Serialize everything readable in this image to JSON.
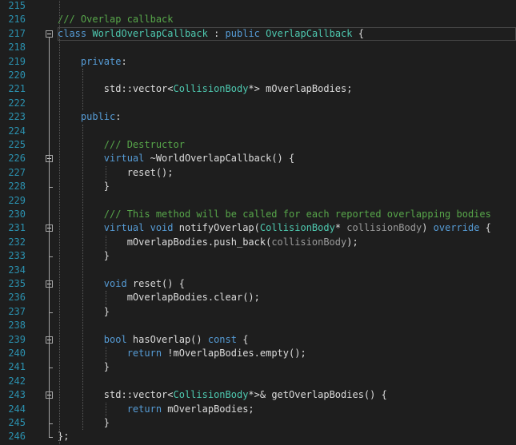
{
  "theme": {
    "background": "#1e1e1e",
    "line_number_color": "#2b91af",
    "keyword_color": "#569cd6",
    "type_color": "#4ec9b0",
    "comment_color": "#57a64a",
    "text_color": "#dcdcdc",
    "parameter_color": "#9a9a9a"
  },
  "icons": {
    "fold": "collapse-minus-icon"
  },
  "current_line": 217,
  "lines": [
    {
      "num": "215",
      "fold": false,
      "segments": []
    },
    {
      "num": "216",
      "fold": false,
      "segments": [
        [
          "cm",
          "/// Overlap callback"
        ]
      ]
    },
    {
      "num": "217",
      "fold": true,
      "segments": [
        [
          "kw",
          "class"
        ],
        [
          "tx",
          " "
        ],
        [
          "ty",
          "WorldOverlapCallback"
        ],
        [
          "tx",
          " : "
        ],
        [
          "kw",
          "public"
        ],
        [
          "tx",
          " "
        ],
        [
          "ty",
          "OverlapCallback"
        ],
        [
          "tx",
          " {"
        ]
      ]
    },
    {
      "num": "218",
      "fold": false,
      "segments": []
    },
    {
      "num": "219",
      "fold": false,
      "segments": [
        [
          "tx",
          "    "
        ],
        [
          "kw",
          "private"
        ],
        [
          "tx",
          ":"
        ]
      ]
    },
    {
      "num": "220",
      "fold": false,
      "segments": []
    },
    {
      "num": "221",
      "fold": false,
      "segments": [
        [
          "tx",
          "        std::vector<"
        ],
        [
          "ty",
          "CollisionBody"
        ],
        [
          "tx",
          "*> mOverlapBodies;"
        ]
      ]
    },
    {
      "num": "222",
      "fold": false,
      "segments": []
    },
    {
      "num": "223",
      "fold": false,
      "segments": [
        [
          "tx",
          "    "
        ],
        [
          "kw",
          "public"
        ],
        [
          "tx",
          ":"
        ]
      ]
    },
    {
      "num": "224",
      "fold": false,
      "segments": []
    },
    {
      "num": "225",
      "fold": false,
      "segments": [
        [
          "tx",
          "        "
        ],
        [
          "cm",
          "/// Destructor"
        ]
      ]
    },
    {
      "num": "226",
      "fold": true,
      "segments": [
        [
          "tx",
          "        "
        ],
        [
          "kw",
          "virtual"
        ],
        [
          "tx",
          " ~WorldOverlapCallback() {"
        ]
      ]
    },
    {
      "num": "227",
      "fold": false,
      "segments": [
        [
          "tx",
          "            reset();"
        ]
      ]
    },
    {
      "num": "228",
      "fold": false,
      "segments": [
        [
          "tx",
          "        }"
        ]
      ]
    },
    {
      "num": "229",
      "fold": false,
      "segments": []
    },
    {
      "num": "230",
      "fold": false,
      "segments": [
        [
          "tx",
          "        "
        ],
        [
          "cm",
          "/// This method will be called for each reported overlapping bodies"
        ]
      ]
    },
    {
      "num": "231",
      "fold": true,
      "segments": [
        [
          "tx",
          "        "
        ],
        [
          "kw",
          "virtual"
        ],
        [
          "tx",
          " "
        ],
        [
          "kw",
          "void"
        ],
        [
          "tx",
          " notifyOverlap("
        ],
        [
          "ty",
          "CollisionBody"
        ],
        [
          "tx",
          "* "
        ],
        [
          "pm",
          "collisionBody"
        ],
        [
          "tx",
          ") "
        ],
        [
          "kw",
          "override"
        ],
        [
          "tx",
          " {"
        ]
      ]
    },
    {
      "num": "232",
      "fold": false,
      "segments": [
        [
          "tx",
          "            mOverlapBodies.push_back("
        ],
        [
          "pm",
          "collisionBody"
        ],
        [
          "tx",
          ");"
        ]
      ]
    },
    {
      "num": "233",
      "fold": false,
      "segments": [
        [
          "tx",
          "        }"
        ]
      ]
    },
    {
      "num": "234",
      "fold": false,
      "segments": []
    },
    {
      "num": "235",
      "fold": true,
      "segments": [
        [
          "tx",
          "        "
        ],
        [
          "kw",
          "void"
        ],
        [
          "tx",
          " reset() {"
        ]
      ]
    },
    {
      "num": "236",
      "fold": false,
      "segments": [
        [
          "tx",
          "            mOverlapBodies.clear();"
        ]
      ]
    },
    {
      "num": "237",
      "fold": false,
      "segments": [
        [
          "tx",
          "        }"
        ]
      ]
    },
    {
      "num": "238",
      "fold": false,
      "segments": []
    },
    {
      "num": "239",
      "fold": true,
      "segments": [
        [
          "tx",
          "        "
        ],
        [
          "kw",
          "bool"
        ],
        [
          "tx",
          " hasOverlap() "
        ],
        [
          "kw",
          "const"
        ],
        [
          "tx",
          " {"
        ]
      ]
    },
    {
      "num": "240",
      "fold": false,
      "segments": [
        [
          "tx",
          "            "
        ],
        [
          "kw",
          "return"
        ],
        [
          "tx",
          " !mOverlapBodies.empty();"
        ]
      ]
    },
    {
      "num": "241",
      "fold": false,
      "segments": [
        [
          "tx",
          "        }"
        ]
      ]
    },
    {
      "num": "242",
      "fold": false,
      "segments": []
    },
    {
      "num": "243",
      "fold": true,
      "segments": [
        [
          "tx",
          "        std::vector<"
        ],
        [
          "ty",
          "CollisionBody"
        ],
        [
          "tx",
          "*>& getOverlapBodies() {"
        ]
      ]
    },
    {
      "num": "244",
      "fold": false,
      "segments": [
        [
          "tx",
          "            "
        ],
        [
          "kw",
          "return"
        ],
        [
          "tx",
          " mOverlapBodies;"
        ]
      ]
    },
    {
      "num": "245",
      "fold": false,
      "segments": [
        [
          "tx",
          "        }"
        ]
      ]
    },
    {
      "num": "246",
      "fold": false,
      "segments": [
        [
          "tx",
          "};"
        ]
      ]
    }
  ]
}
